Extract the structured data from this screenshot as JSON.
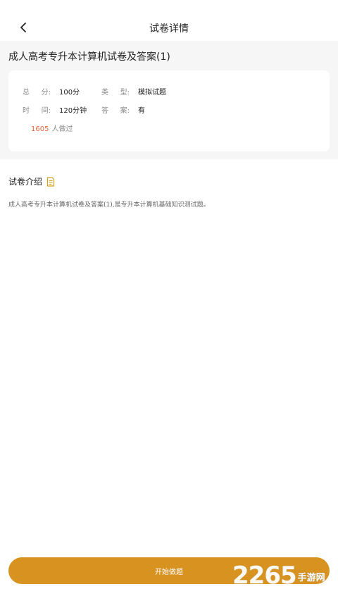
{
  "nav": {
    "title": "试卷详情"
  },
  "paper": {
    "title": "成人高考专升本计算机试卷及答案(1)",
    "score_label": [
      "总",
      "分:"
    ],
    "score_value": "100分",
    "type_label": [
      "类",
      "型:"
    ],
    "type_value": "模拟试题",
    "time_label": [
      "时",
      "间:"
    ],
    "time_value": "120分钟",
    "answer_label": [
      "答",
      "案:"
    ],
    "answer_value": "有",
    "done_count": "1605",
    "done_text": "人做过"
  },
  "intro": {
    "title": "试卷介绍",
    "text": "成人高考专升本计算机试卷及答案(1),是专升本计算机基础知识测试题。"
  },
  "start_button": {
    "label": "开始做题"
  },
  "watermark": {
    "number": "2265",
    "text": "手游网"
  },
  "colors": {
    "accent": "#d7921f",
    "count": "#e8673a"
  }
}
